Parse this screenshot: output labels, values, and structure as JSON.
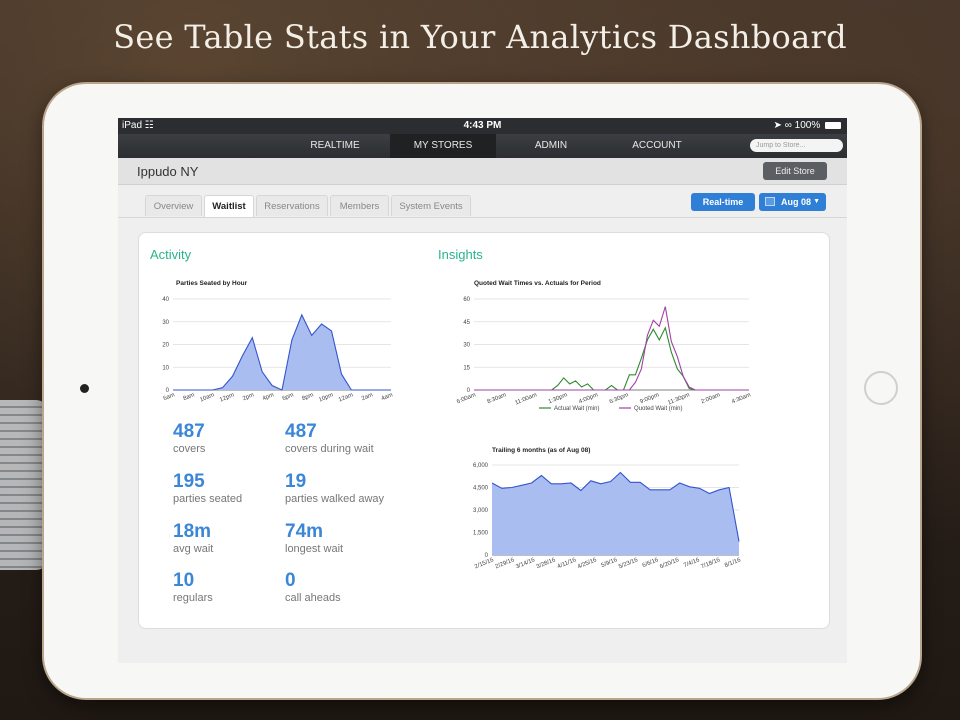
{
  "headline": "See Table Stats in Your Analytics Dashboard",
  "status_bar": {
    "device": "iPad",
    "time": "4:43 PM",
    "battery": "100%"
  },
  "nav": {
    "items": [
      "REALTIME",
      "MY STORES",
      "ADMIN",
      "ACCOUNT"
    ],
    "active": "MY STORES",
    "search_placeholder": "Jump to Store..."
  },
  "store": {
    "name": "Ippudo NY",
    "edit_label": "Edit Store"
  },
  "tabs": [
    "Overview",
    "Waitlist",
    "Reservations",
    "Members",
    "System Events"
  ],
  "active_tab": "Waitlist",
  "controls": {
    "realtime_label": "Real-time",
    "date_label": "Aug 08"
  },
  "activity": {
    "title": "Activity",
    "stats": [
      {
        "value": "487",
        "label": "covers"
      },
      {
        "value": "487",
        "label": "covers during wait"
      },
      {
        "value": "195",
        "label": "parties seated"
      },
      {
        "value": "19",
        "label": "parties walked away"
      },
      {
        "value": "18m",
        "label": "avg wait"
      },
      {
        "value": "74m",
        "label": "longest wait"
      },
      {
        "value": "10",
        "label": "regulars"
      },
      {
        "value": "0",
        "label": "call aheads"
      }
    ]
  },
  "insights": {
    "title": "Insights"
  },
  "colors": {
    "accent_green": "#2bb38d",
    "stat_blue": "#3b86d6",
    "area_blue": "#3355cc",
    "area_fill": "#a9bdf0",
    "actual": "#2e8b2e",
    "quoted": "#a040a8",
    "button_blue": "#2f7fd6"
  },
  "chart_data": [
    {
      "type": "area",
      "title": "Parties Seated by Hour",
      "ylim": [
        0,
        40
      ],
      "yticks": [
        "0",
        "10",
        "20",
        "30",
        "40"
      ],
      "x": [
        "6am",
        "7am",
        "8am",
        "9am",
        "10am",
        "11am",
        "12pm",
        "1pm",
        "2pm",
        "3pm",
        "4pm",
        "5pm",
        "6pm",
        "7pm",
        "8pm",
        "9pm",
        "10pm",
        "11pm",
        "12am",
        "1am",
        "2am",
        "3am",
        "4am"
      ],
      "xtick_labels": [
        "6am",
        "8am",
        "10am",
        "12pm",
        "2pm",
        "4pm",
        "6pm",
        "8pm",
        "10pm",
        "12am",
        "2am",
        "4am"
      ],
      "values": [
        0,
        0,
        0,
        0,
        0,
        1,
        6,
        15,
        23,
        8,
        2,
        0,
        22,
        33,
        24,
        29,
        26,
        7,
        0,
        0,
        0,
        0,
        0
      ]
    },
    {
      "type": "line",
      "title": "Quoted Wait Times vs. Actuals for Period",
      "ylim": [
        0,
        60
      ],
      "yticks": [
        "0",
        "15",
        "30",
        "45",
        "60"
      ],
      "xtick_labels": [
        "6:00am",
        "8:30am",
        "11:00am",
        "1:30pm",
        "4:00pm",
        "6:30pm",
        "9:00pm",
        "11:30pm",
        "2:00am",
        "4:30am"
      ],
      "x": [
        "6:00am",
        "6:30am",
        "7:00am",
        "7:30am",
        "8:00am",
        "8:30am",
        "9:00am",
        "9:30am",
        "10:00am",
        "10:30am",
        "11:00am",
        "11:30am",
        "12:00pm",
        "12:30pm",
        "1:00pm",
        "1:30pm",
        "2:00pm",
        "2:30pm",
        "3:00pm",
        "3:30pm",
        "4:00pm",
        "4:30pm",
        "5:00pm",
        "5:30pm",
        "6:00pm",
        "6:30pm",
        "7:00pm",
        "7:30pm",
        "8:00pm",
        "8:30pm",
        "9:00pm",
        "9:30pm",
        "10:00pm",
        "10:30pm",
        "11:00pm",
        "11:30pm",
        "12:00am",
        "12:30am",
        "1:00am",
        "1:30am",
        "2:00am",
        "2:30am",
        "3:00am",
        "3:30am",
        "4:00am",
        "4:30am",
        "5:00am"
      ],
      "series": [
        {
          "name": "Actual Wait (min)",
          "values": [
            0,
            0,
            0,
            0,
            0,
            0,
            0,
            0,
            0,
            0,
            0,
            0,
            0,
            0,
            3,
            8,
            4,
            6,
            2,
            4,
            0,
            0,
            0,
            3,
            0,
            0,
            10,
            10,
            21,
            33,
            40,
            33,
            41,
            25,
            14,
            9,
            1,
            0,
            0,
            0,
            0,
            0,
            0,
            0,
            0,
            0,
            0
          ]
        },
        {
          "name": "Quoted Wait (min)",
          "values": [
            0,
            0,
            0,
            0,
            0,
            0,
            0,
            0,
            0,
            0,
            0,
            0,
            0,
            0,
            0,
            0,
            0,
            0,
            0,
            0,
            0,
            0,
            0,
            0,
            0,
            0,
            0,
            5,
            14,
            36,
            46,
            42,
            55,
            32,
            22,
            9,
            2,
            0,
            0,
            0,
            0,
            0,
            0,
            0,
            0,
            0,
            0
          ]
        }
      ],
      "legend": "bottom"
    },
    {
      "type": "area",
      "title": "Trailing 6 months (as of Aug 08)",
      "ylim": [
        0,
        6000
      ],
      "yticks": [
        "0",
        "1,500",
        "3,000",
        "4,500",
        "6,000"
      ],
      "categories": [
        "2/15/16",
        "2/22/16",
        "2/29/16",
        "3/7/16",
        "3/14/16",
        "3/21/16",
        "3/28/16",
        "4/4/16",
        "4/11/16",
        "4/18/16",
        "4/25/16",
        "5/2/16",
        "5/9/16",
        "5/16/16",
        "5/23/16",
        "5/30/16",
        "6/6/16",
        "6/13/16",
        "6/20/16",
        "6/27/16",
        "7/4/16",
        "7/11/16",
        "7/18/16",
        "7/25/16",
        "8/1/16",
        "8/8/16"
      ],
      "xtick_labels": [
        "2/15/16",
        "2/29/16",
        "3/14/16",
        "3/28/16",
        "4/11/16",
        "4/25/16",
        "5/9/16",
        "5/23/16",
        "6/6/16",
        "6/20/16",
        "7/4/16",
        "7/18/16",
        "8/1/16"
      ],
      "values": [
        4800,
        4450,
        4500,
        4650,
        4800,
        5300,
        4750,
        4750,
        4800,
        4300,
        4950,
        4750,
        4900,
        5500,
        4850,
        4850,
        4350,
        4350,
        4350,
        4800,
        4550,
        4450,
        4100,
        4350,
        4500,
        900
      ]
    }
  ]
}
